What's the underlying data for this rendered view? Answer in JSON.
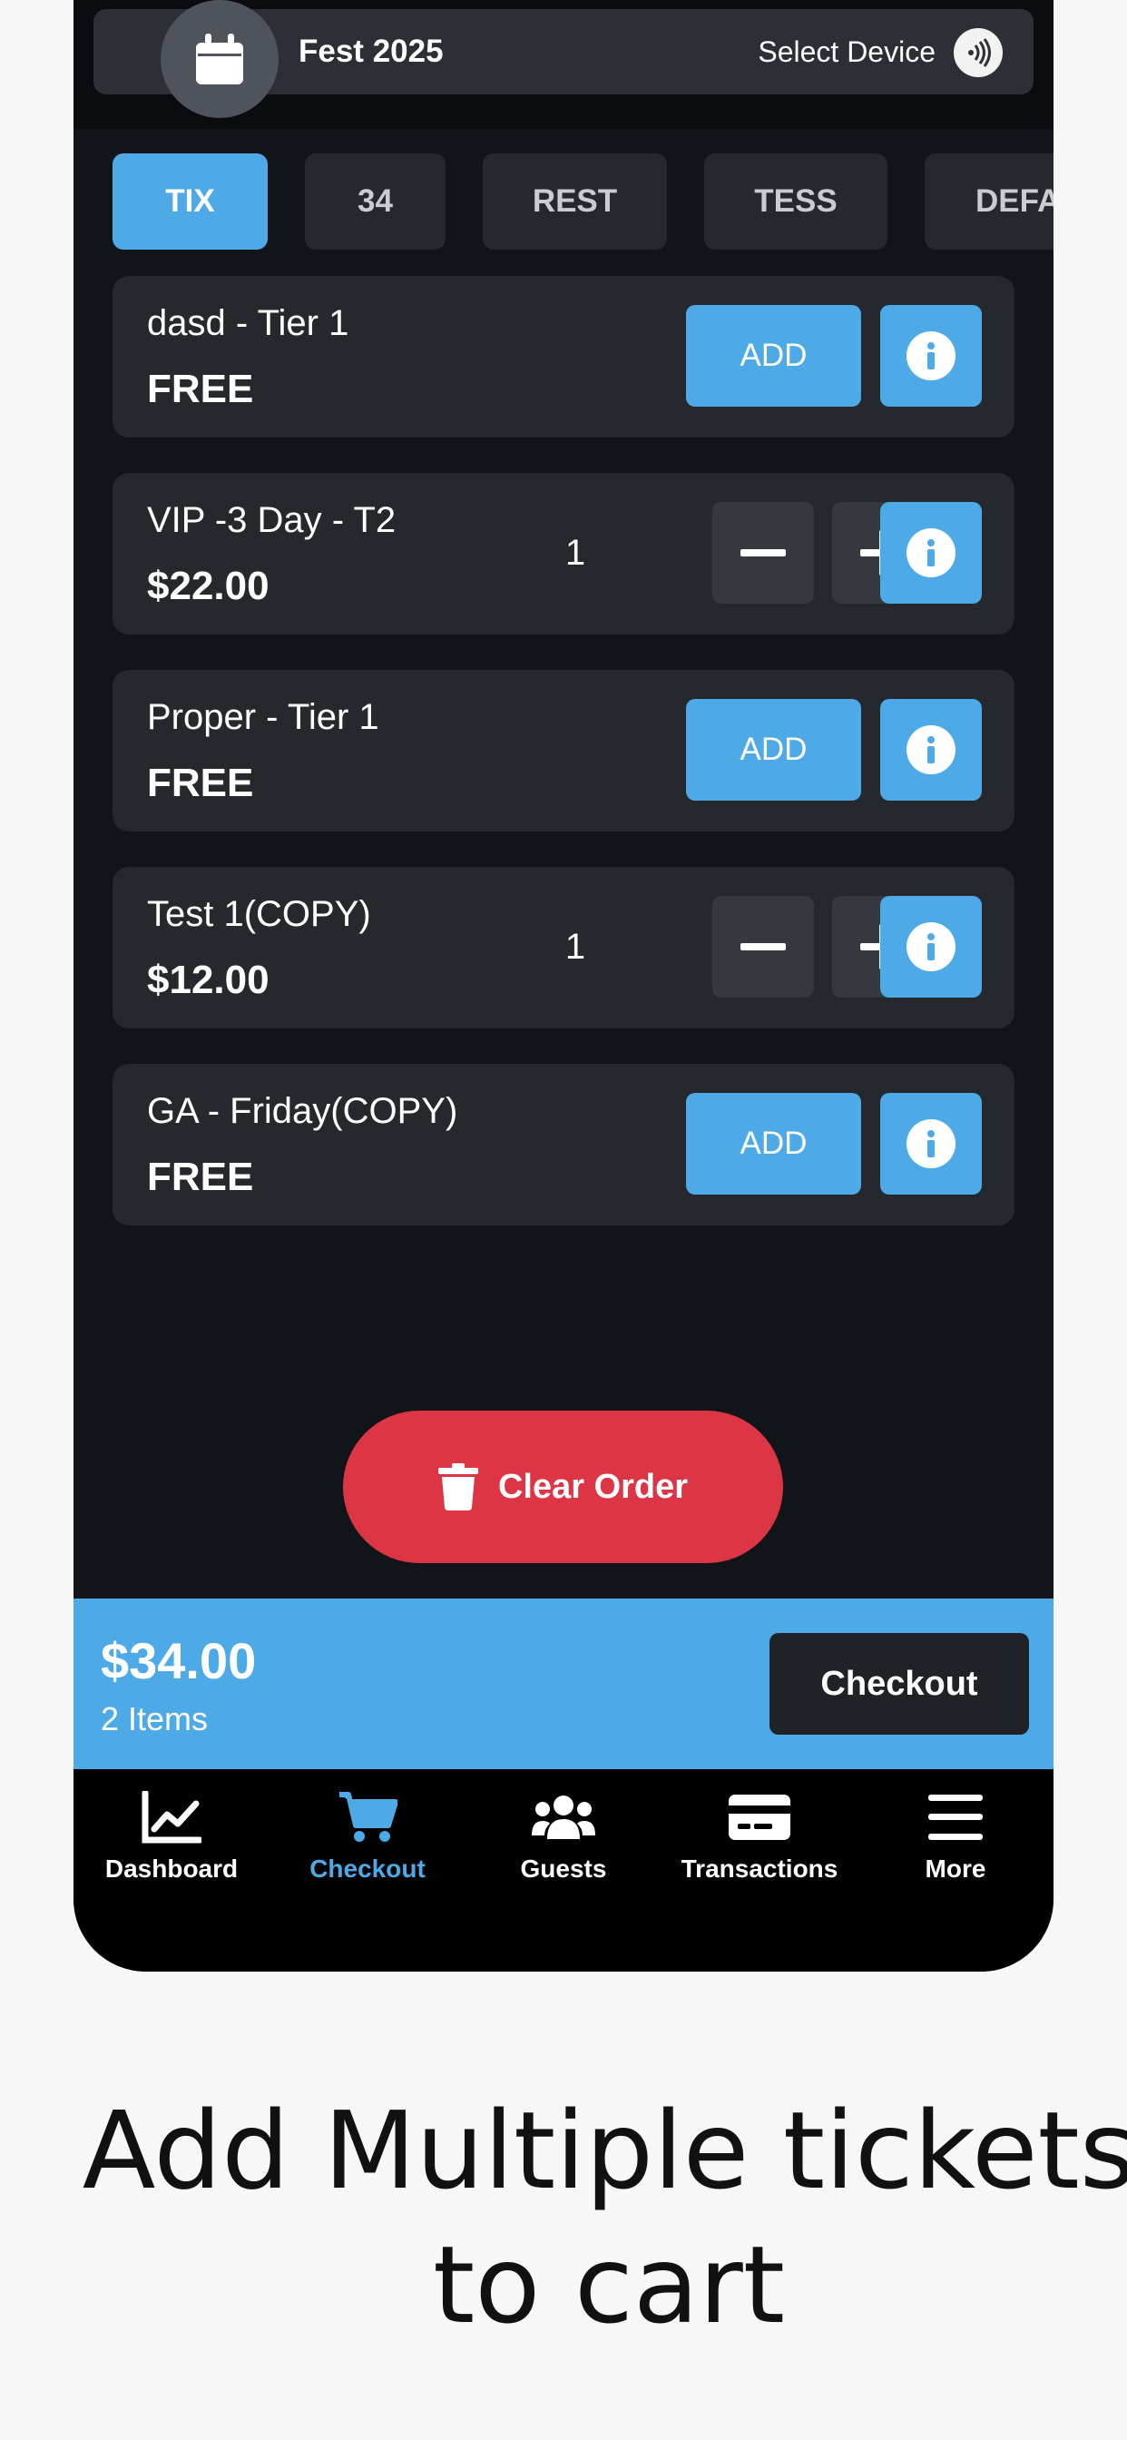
{
  "header": {
    "event_title": "Fest 2025",
    "select_device_label": "Select Device",
    "calendar_icon": "calendar-icon",
    "nfc_icon": "nfc-icon"
  },
  "tabs": [
    {
      "label": "TIX",
      "active": true
    },
    {
      "label": "34",
      "active": false
    },
    {
      "label": "REST",
      "active": false
    },
    {
      "label": "TESS",
      "active": false
    },
    {
      "label": "DEFA",
      "active": false
    }
  ],
  "tickets": [
    {
      "name": "dasd - Tier 1",
      "price": "FREE",
      "mode": "add",
      "add_label": "ADD"
    },
    {
      "name": "VIP -3 Day - T2",
      "price": "$22.00",
      "mode": "qty",
      "quantity": "1"
    },
    {
      "name": "Proper - Tier 1",
      "price": "FREE",
      "mode": "add",
      "add_label": "ADD"
    },
    {
      "name": "Test 1(COPY)",
      "price": "$12.00",
      "mode": "qty",
      "quantity": "1"
    },
    {
      "name": "GA - Friday(COPY)",
      "price": "FREE",
      "mode": "add",
      "add_label": "ADD"
    }
  ],
  "clear_order_label": "Clear Order",
  "summary": {
    "total": "$34.00",
    "items": "2 Items",
    "checkout_label": "Checkout"
  },
  "nav": [
    {
      "label": "Dashboard",
      "icon": "chart-line-icon",
      "active": false
    },
    {
      "label": "Checkout",
      "icon": "cart-icon",
      "active": true
    },
    {
      "label": "Guests",
      "icon": "users-icon",
      "active": false
    },
    {
      "label": "Transactions",
      "icon": "credit-card-icon",
      "active": false
    },
    {
      "label": "More",
      "icon": "menu-icon",
      "active": false
    }
  ],
  "caption": {
    "line1": "Add Multiple tickets",
    "line2": "to cart"
  },
  "colors": {
    "accent": "#4daae6",
    "danger": "#dc3545",
    "card": "#25282d",
    "background": "#111418"
  }
}
